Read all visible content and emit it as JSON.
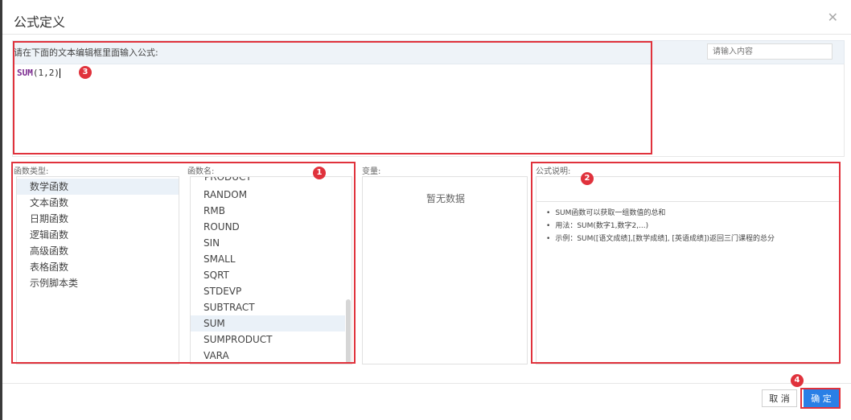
{
  "dialog": {
    "title": "公式定义",
    "close_icon": "close-icon"
  },
  "editor": {
    "label": "请在下面的文本编辑框里面输入公式:",
    "search_placeholder": "请输入内容",
    "formula_fn": "SUM",
    "formula_args": "(1,2)"
  },
  "function_types": {
    "label": "函数类型:",
    "items": [
      "数学函数",
      "文本函数",
      "日期函数",
      "逻辑函数",
      "高级函数",
      "表格函数",
      "示例脚本类"
    ],
    "selected": "数学函数"
  },
  "function_names": {
    "label": "函数名:",
    "partial_top": "PRODUCT",
    "items": [
      "RANDOM",
      "RMB",
      "ROUND",
      "SIN",
      "SMALL",
      "SQRT",
      "STDEVP",
      "SUBTRACT",
      "SUM",
      "SUMPRODUCT",
      "VARA"
    ],
    "selected": "SUM"
  },
  "variables": {
    "label": "变量:",
    "empty_text": "暂无数据"
  },
  "description": {
    "label": "公式说明:",
    "lines": [
      "SUM函数可以获取一组数值的总和",
      "用法：SUM(数字1,数字2,...)",
      "示例：SUM([语文成绩],[数学成绩], [英语成绩])返回三门课程的总分"
    ]
  },
  "footer": {
    "cancel_label": "取 消",
    "ok_label": "确 定"
  },
  "annotations": {
    "badge_1": "1",
    "badge_2": "2",
    "badge_3": "3",
    "badge_4": "4",
    "color": "#e0323c"
  }
}
